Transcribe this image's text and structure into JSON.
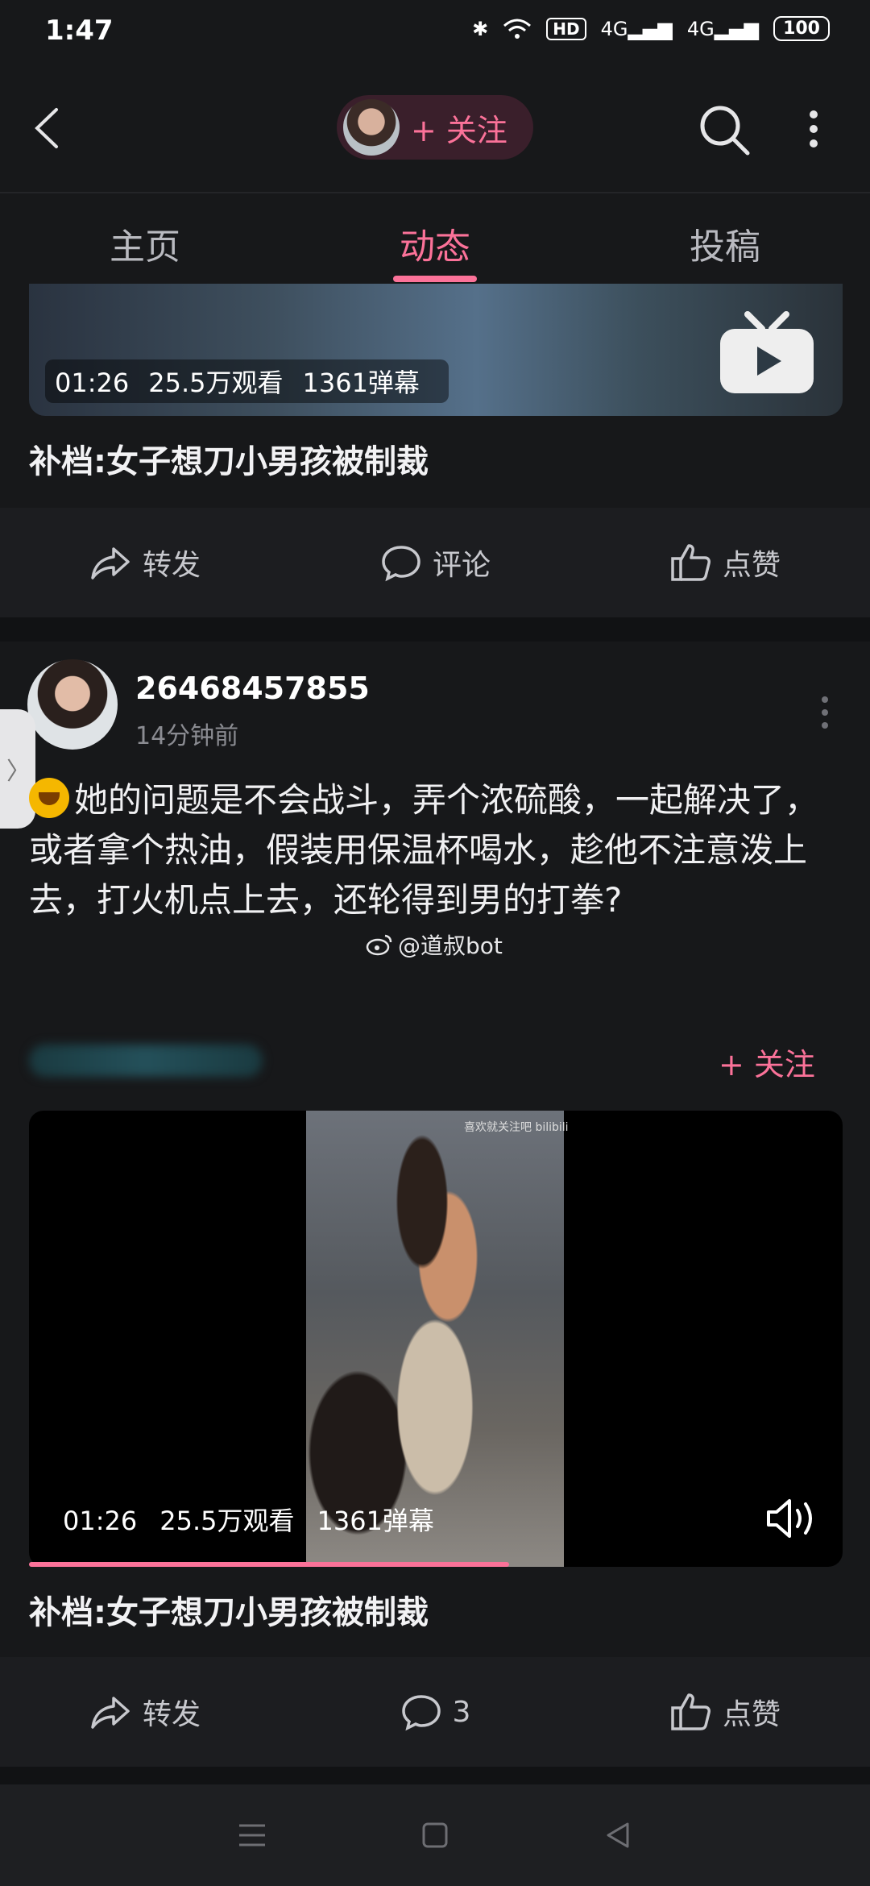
{
  "status_bar": {
    "time": "1:47",
    "hd_label": "HD",
    "net1": "4G",
    "net2": "4G",
    "battery": "100"
  },
  "header": {
    "follow_label": "+ 关注"
  },
  "tabs": [
    {
      "label": "主页",
      "active": false
    },
    {
      "label": "动态",
      "active": true
    },
    {
      "label": "投稿",
      "active": false
    }
  ],
  "card1": {
    "duration": "01:26",
    "views": "25.5万观看",
    "danmaku": "1361弹幕",
    "title": "补档:女子想刀小男孩被制裁",
    "actions": {
      "share": "转发",
      "comment": "评论",
      "like": "点赞"
    }
  },
  "post": {
    "username": "26468457855",
    "time": "14分钟前",
    "text": "她的问题是不会战斗，弄个浓硫酸，一起解决了，或者拿个热油，假装用保温杯喝水，趁他不注意泼上去，打火机点上去，还轮得到男的打拳?",
    "watermark": "@道叔bot"
  },
  "card2": {
    "follow_label": "+ 关注",
    "video_tag": "喜欢就关注吧 bilibili",
    "duration": "01:26",
    "views": "25.5万观看",
    "danmaku": "1361弹幕",
    "progress": 0.59,
    "title": "补档:女子想刀小男孩被制裁",
    "actions": {
      "share": "转发",
      "comment": "3",
      "like": "点赞"
    }
  },
  "colors": {
    "accent": "#fb7299",
    "background": "#111214",
    "card": "#17181a"
  }
}
